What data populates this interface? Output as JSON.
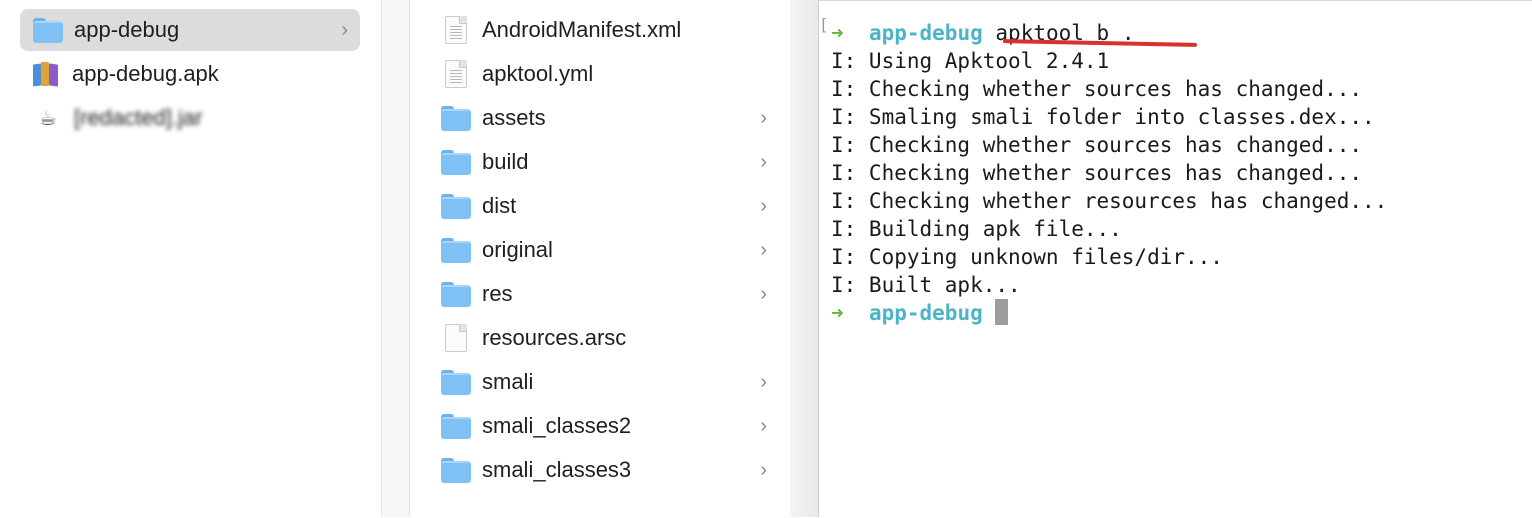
{
  "finder": {
    "column1": {
      "items": [
        {
          "label": "app-debug",
          "icon": "folder-icon",
          "selected": true,
          "has_children": true
        },
        {
          "label": "app-debug.apk",
          "icon": "apk-package-icon",
          "selected": false,
          "has_children": false
        },
        {
          "label": "[redacted].jar",
          "icon": "java-cup-icon",
          "selected": false,
          "has_children": false,
          "blurred": true
        }
      ]
    },
    "column2": {
      "items": [
        {
          "label": "AndroidManifest.xml",
          "icon": "document-icon",
          "has_children": false
        },
        {
          "label": "apktool.yml",
          "icon": "document-icon",
          "has_children": false
        },
        {
          "label": "assets",
          "icon": "folder-icon",
          "has_children": true
        },
        {
          "label": "build",
          "icon": "folder-icon",
          "has_children": true
        },
        {
          "label": "dist",
          "icon": "folder-icon",
          "has_children": true
        },
        {
          "label": "original",
          "icon": "folder-icon",
          "has_children": true
        },
        {
          "label": "res",
          "icon": "folder-icon",
          "has_children": true
        },
        {
          "label": "resources.arsc",
          "icon": "blank-document-icon",
          "has_children": false
        },
        {
          "label": "smali",
          "icon": "folder-icon",
          "has_children": true
        },
        {
          "label": "smali_classes2",
          "icon": "folder-icon",
          "has_children": true
        },
        {
          "label": "smali_classes3",
          "icon": "folder-icon",
          "has_children": true
        }
      ]
    },
    "chevron": "›"
  },
  "terminal": {
    "prompt_arrow": "➜",
    "prompt_dir": "app-debug",
    "command": "apktool b .",
    "output": [
      "I: Using Apktool 2.4.1",
      "I: Checking whether sources has changed...",
      "I: Smaling smali folder into classes.dex...",
      "I: Checking whether sources has changed...",
      "I: Checking whether sources has changed...",
      "I: Checking whether resources has changed...",
      "I: Building apk file...",
      "I: Copying unknown files/dir...",
      "I: Built apk..."
    ],
    "colors": {
      "arrow": "#5fb541",
      "dir": "#4cb4c6",
      "annotation_underline": "#d9322c"
    }
  }
}
